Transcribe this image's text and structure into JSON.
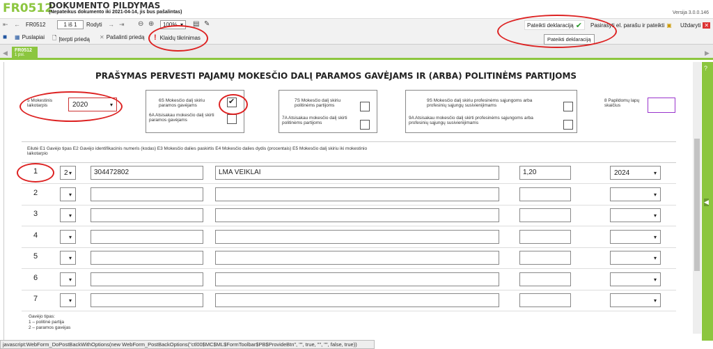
{
  "header": {
    "form_code": "FR0512",
    "title": "DOKUMENTO PILDYMAS",
    "subtitle": "(Nepateikus dokumento iki 2021-04-14, jis bus pašalintas)",
    "version": "Versija 3.0.0.146"
  },
  "toolbar1": {
    "form_label": "FR0512",
    "page_value": "1 iš 1",
    "show_label": "Rodyti",
    "zoom_value": "100%",
    "submit_label": "Pateikti deklaraciją",
    "sign_label": "Pasirašyti el. parašu ir pateikti",
    "close_label": "Uždaryti"
  },
  "toolbar2": {
    "save_label": "",
    "pages_label": "Puslapiai",
    "insert_label": "Įterpti priedą",
    "remove_label": "Pašalinti priedą",
    "check_label": "Klaidų tikrinimas"
  },
  "tooltip": "Pateikti deklaraciją",
  "tab": {
    "label": "FR0512",
    "sub": "1 psl."
  },
  "form": {
    "title": "PRAŠYMAS PERVESTI PAJAMŲ MOKESČIO DALĮ PARAMOS GAVĖJAMS IR (ARBA) POLITINĖMS PARTIJOMS",
    "period_label": "5 Mokestinis laikotarpis",
    "period_value": "2020",
    "g6s": "6S Mokesčio dalį skiriu paramos gavėjams",
    "g6a": "6A Atsisakau mokesčio dalį skirti paramos gavėjams",
    "g7s": "7S Mokesčio dalį skiriu politinėms partijoms",
    "g7a": "7A Atsisakau mokesčio dalį skirti politinėms partijoms",
    "g9s": "9S Mokesčio dalį skiriu profesinėms sąjungoms arba profesinių sąjungų susivienijimams",
    "g9a": "9A Atsisakau mokesčio dalį skirti profesinėms sąjungoms arba profesinių sąjungų susivienijimams",
    "extra_pages_label": "8 Papildomų lapų skaičius",
    "columns_header": "Eilutė E1 Gavėjo tipas E2 Gavėjo identifikacinis numeris (kodas) E3 Mokesčio dalies paskirtis E4 Mokesčio dalies dydis (procentais) E5 Mokesčio dalį skiriu iki mokestinio laikotarpio",
    "rows": [
      {
        "num": "1",
        "type": "2",
        "code": "304472802",
        "purpose": "LMA VEIKLAI",
        "percent": "1,20",
        "year": "2024"
      },
      {
        "num": "2",
        "type": "",
        "code": "",
        "purpose": "",
        "percent": "",
        "year": ""
      },
      {
        "num": "3",
        "type": "",
        "code": "",
        "purpose": "",
        "percent": "",
        "year": ""
      },
      {
        "num": "4",
        "type": "",
        "code": "",
        "purpose": "",
        "percent": "",
        "year": ""
      },
      {
        "num": "5",
        "type": "",
        "code": "",
        "purpose": "",
        "percent": "",
        "year": ""
      },
      {
        "num": "6",
        "type": "",
        "code": "",
        "purpose": "",
        "percent": "",
        "year": ""
      },
      {
        "num": "7",
        "type": "",
        "code": "",
        "purpose": "",
        "percent": "",
        "year": ""
      }
    ],
    "legend_title": "Gavėjo tipas:",
    "legend_1": "1 – politinė partija",
    "legend_2": "2 – paramos gavėjas"
  },
  "statusbar": "javascript:WebForm_DoPostBackWithOptions(new WebForm_PostBackOptions(\"ctl00$MC$ML$FormToolbar$PB$ProvideBtn\", \"\", true, \"\", \"\", false, true))",
  "colors": {
    "accent": "#8cc63f",
    "annotation": "#d22222"
  }
}
